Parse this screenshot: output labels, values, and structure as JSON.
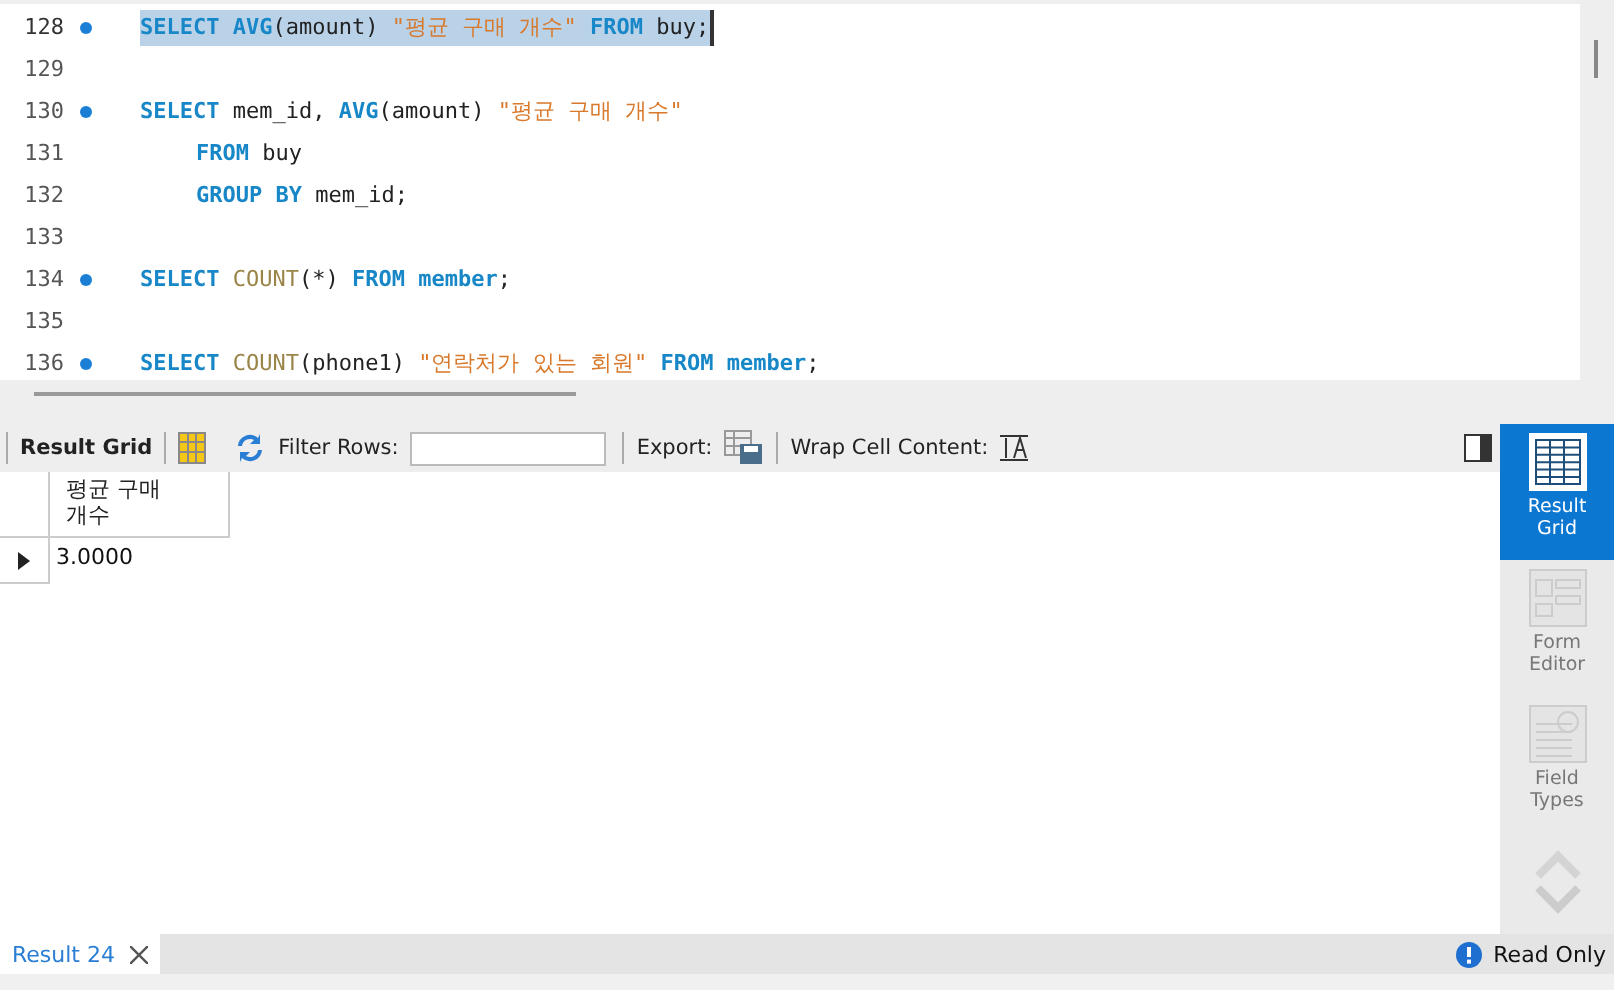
{
  "editor": {
    "lines": [
      {
        "number": "128",
        "marker": true,
        "selected": true,
        "tokens": [
          {
            "kind": "keyword",
            "text": "SELECT AVG"
          },
          {
            "kind": "plain",
            "text": "(amount) "
          },
          {
            "kind": "string",
            "text": "\"평균 구매 개수\""
          },
          {
            "kind": "keyword",
            "text": " FROM"
          },
          {
            "kind": "plain",
            "text": " buy;"
          }
        ]
      },
      {
        "number": "129",
        "marker": false,
        "selected": false
      },
      {
        "number": "130",
        "marker": true,
        "selected": false,
        "tokens": [
          {
            "kind": "keyword",
            "text": "SELECT"
          },
          {
            "kind": "plain",
            "text": " mem_id, "
          },
          {
            "kind": "keyword",
            "text": "AVG"
          },
          {
            "kind": "plain",
            "text": "(amount) "
          },
          {
            "kind": "string",
            "text": "\"평균 구매 개수\""
          }
        ],
        "children": [
          {
            "number": "131",
            "marker": false,
            "selected": false,
            "tokens": [
              {
                "kind": "keyword",
                "text": "FROM"
              },
              {
                "kind": "plain",
                "text": " buy"
              }
            ]
          },
          {
            "number": "132",
            "marker": false,
            "selected": false,
            "tokens": [
              {
                "kind": "keyword",
                "text": "GROUP BY"
              },
              {
                "kind": "plain",
                "text": " mem_id;"
              }
            ]
          }
        ]
      },
      {
        "number": "133",
        "marker": false,
        "selected": false
      },
      {
        "number": "134",
        "marker": true,
        "selected": false,
        "tokens": [
          {
            "kind": "keyword",
            "text": "SELECT "
          },
          {
            "kind": "function",
            "text": "COUNT"
          },
          {
            "kind": "plain",
            "text": "(*) "
          },
          {
            "kind": "keyword",
            "text": "FROM member"
          },
          {
            "kind": "plain",
            "text": ";"
          }
        ]
      },
      {
        "number": "135",
        "marker": false,
        "selected": false
      },
      {
        "number": "136",
        "marker": true,
        "selected": false,
        "tokens": [
          {
            "kind": "keyword",
            "text": "SELECT "
          },
          {
            "kind": "function",
            "text": "COUNT"
          },
          {
            "kind": "plain",
            "text": "(phone1) "
          },
          {
            "kind": "string",
            "text": "\"연락처가 있는 회원\""
          },
          {
            "kind": "keyword",
            "text": " FROM member"
          },
          {
            "kind": "plain",
            "text": ";"
          }
        ]
      }
    ]
  },
  "toolbar": {
    "result_grid": "Result Grid",
    "filter_label": "Filter Rows:",
    "export_label": "Export:",
    "wrap_label": "Wrap Cell Content:"
  },
  "grid": {
    "columns": [
      "평균 구매 개수"
    ],
    "rows": [
      {
        "selected": true,
        "cells": [
          "3.0000"
        ]
      }
    ]
  },
  "side_tabs": [
    {
      "label": "Result Grid",
      "selected": true,
      "disabled": false
    },
    {
      "label": "Form Editor",
      "selected": false,
      "disabled": true
    },
    {
      "label": "Field Types",
      "selected": false,
      "disabled": true
    }
  ],
  "result_tabs": [
    {
      "label": "Result 24",
      "selected": true
    }
  ],
  "status": "Read Only"
}
